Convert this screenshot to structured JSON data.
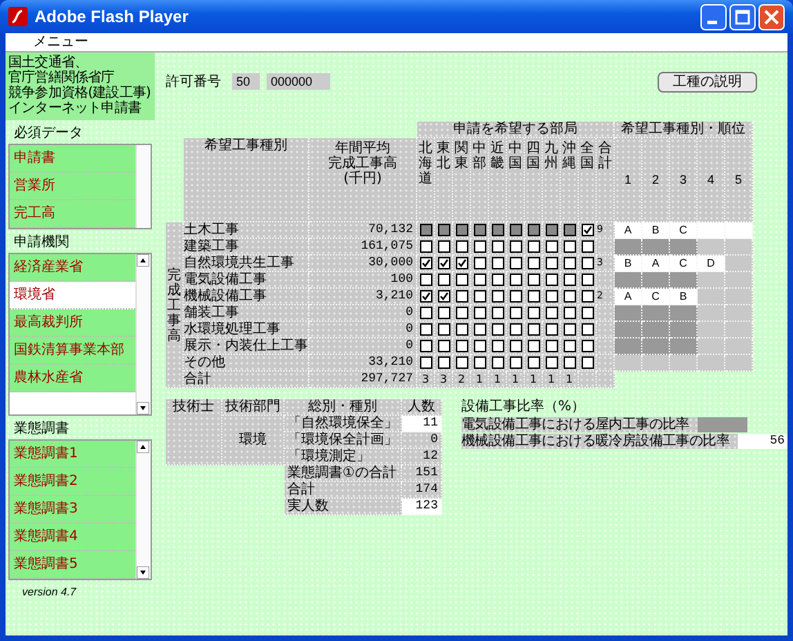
{
  "window": {
    "title": "Adobe Flash Player"
  },
  "menu": [
    "メニュー"
  ],
  "applicant_lines": [
    "国土交通省、",
    "官庁営繕関係省庁",
    "競争参加資格(建設工事)",
    "インターネット申請書"
  ],
  "permit": {
    "label": "許可番号",
    "prefix": "50",
    "number": "000000"
  },
  "help_button": "工種の説明",
  "sidebar": {
    "sections": [
      {
        "title": "必須データ",
        "scroll_arrows": false,
        "items": [
          {
            "label": "申請書",
            "selected": false
          },
          {
            "label": "営業所",
            "selected": false
          },
          {
            "label": "完工高",
            "selected": false
          }
        ]
      },
      {
        "title": "申請機関",
        "scroll_arrows": true,
        "items": [
          {
            "label": "経済産業省",
            "selected": false
          },
          {
            "label": "環境省",
            "selected": true
          },
          {
            "label": "最高裁判所",
            "selected": false
          },
          {
            "label": "国鉄清算事業本部",
            "selected": false
          },
          {
            "label": "農林水産省",
            "selected": false
          }
        ]
      },
      {
        "title": "業態調書",
        "scroll_arrows": true,
        "items": [
          {
            "label": "業態調書1",
            "selected": false
          },
          {
            "label": "業態調書2",
            "selected": false
          },
          {
            "label": "業態調書3",
            "selected": false
          },
          {
            "label": "業態調書4",
            "selected": false
          },
          {
            "label": "業態調書5",
            "selected": false
          }
        ]
      }
    ]
  },
  "version": "version 4.7",
  "table": {
    "group_headers": [
      "申請を希望する部局",
      "希望工事種別・順位"
    ],
    "type_header": "希望工事種別",
    "amount_header": [
      "年間平均",
      "完成工事高",
      "(千円)"
    ],
    "regions": [
      "北海道",
      "東北",
      "関東",
      "中部",
      "近畿",
      "中国",
      "四国",
      "九州",
      "沖縄",
      "全国",
      "合計"
    ],
    "ranks": [
      "1",
      "2",
      "3",
      "4",
      "5"
    ],
    "side_label": "完成工事高",
    "rows": [
      {
        "name": "土木工事",
        "amount": "70,132",
        "regions_disabled": true,
        "checks": [
          false,
          false,
          false,
          false,
          false,
          false,
          false,
          false,
          false,
          true
        ],
        "count": "9",
        "ranks": [
          {
            "kind": "input",
            "text": "A"
          },
          {
            "kind": "input",
            "text": "B"
          },
          {
            "kind": "input",
            "text": "C"
          },
          {
            "kind": "input"
          },
          {
            "kind": "input"
          }
        ]
      },
      {
        "name": "建築工事",
        "amount": "161,075",
        "regions_disabled": false,
        "checks": [
          false,
          false,
          false,
          false,
          false,
          false,
          false,
          false,
          false,
          false
        ],
        "ranks": [
          {
            "kind": "off"
          },
          {
            "kind": "off"
          },
          {
            "kind": "off"
          },
          {
            "kind": "none"
          },
          {
            "kind": "none"
          }
        ]
      },
      {
        "name": "自然環境共生工事",
        "amount": "30,000",
        "regions_disabled": false,
        "checks": [
          true,
          true,
          true,
          false,
          false,
          false,
          false,
          false,
          false,
          false
        ],
        "count": "3",
        "ranks": [
          {
            "kind": "input",
            "text": "B"
          },
          {
            "kind": "input",
            "text": "A"
          },
          {
            "kind": "input",
            "text": "C"
          },
          {
            "kind": "input",
            "text": "D"
          },
          {
            "kind": "none"
          }
        ]
      },
      {
        "name": "電気設備工事",
        "amount": "100",
        "regions_disabled": false,
        "checks": [
          false,
          false,
          false,
          false,
          false,
          false,
          false,
          false,
          false,
          false
        ],
        "ranks": [
          {
            "kind": "off"
          },
          {
            "kind": "off"
          },
          {
            "kind": "off"
          },
          {
            "kind": "none"
          },
          {
            "kind": "none"
          }
        ]
      },
      {
        "name": "機械設備工事",
        "amount": "3,210",
        "regions_disabled": false,
        "checks": [
          true,
          true,
          false,
          false,
          false,
          false,
          false,
          false,
          false,
          false
        ],
        "count": "2",
        "ranks": [
          {
            "kind": "input",
            "text": "A"
          },
          {
            "kind": "input",
            "text": "C"
          },
          {
            "kind": "input",
            "text": "B"
          },
          {
            "kind": "none"
          },
          {
            "kind": "none"
          }
        ]
      },
      {
        "name": "舗装工事",
        "amount": "0",
        "regions_disabled": false,
        "checks": [
          false,
          false,
          false,
          false,
          false,
          false,
          false,
          false,
          false,
          false
        ],
        "ranks": [
          {
            "kind": "off"
          },
          {
            "kind": "off"
          },
          {
            "kind": "off"
          },
          {
            "kind": "none"
          },
          {
            "kind": "none"
          }
        ]
      },
      {
        "name": "水環境処理工事",
        "amount": "0",
        "regions_disabled": false,
        "checks": [
          false,
          false,
          false,
          false,
          false,
          false,
          false,
          false,
          false,
          false
        ],
        "ranks": [
          {
            "kind": "off"
          },
          {
            "kind": "off"
          },
          {
            "kind": "off"
          },
          {
            "kind": "none"
          },
          {
            "kind": "none"
          }
        ]
      },
      {
        "name": "展示・内装仕上工事",
        "amount": "0",
        "regions_disabled": false,
        "checks": [
          false,
          false,
          false,
          false,
          false,
          false,
          false,
          false,
          false,
          false
        ],
        "ranks": [
          {
            "kind": "off"
          },
          {
            "kind": "off"
          },
          {
            "kind": "off"
          },
          {
            "kind": "none"
          },
          {
            "kind": "none"
          }
        ]
      },
      {
        "name": "その他",
        "amount": "33,210",
        "regions_disabled": false,
        "checks": [
          false,
          false,
          false,
          false,
          false,
          false,
          false,
          false,
          false,
          false
        ],
        "ranks": [
          {
            "kind": "none"
          },
          {
            "kind": "none"
          },
          {
            "kind": "none"
          },
          {
            "kind": "none"
          },
          {
            "kind": "none"
          }
        ]
      }
    ],
    "total": {
      "name": "合計",
      "amount": "297,727",
      "counts": [
        "3",
        "3",
        "2",
        "1",
        "1",
        "1",
        "1",
        "1",
        "1"
      ]
    }
  },
  "engineers": {
    "title": "技術士",
    "columns": [
      "技術部門",
      "総別・種別",
      "人数"
    ],
    "department": "環境",
    "rows": [
      {
        "label": "「自然環境保全」",
        "count": "11",
        "kind": "input"
      },
      {
        "label": "「環境保全計画」",
        "count": "0",
        "kind": "calc"
      },
      {
        "label": "「環境測定」",
        "count": "12",
        "kind": "calc"
      },
      {
        "label": "業態調書①の合計",
        "count": "151",
        "kind": "calc"
      },
      {
        "label": "合計",
        "count": "174",
        "kind": "calc"
      },
      {
        "label": "実人数",
        "count": "123",
        "kind": "input"
      }
    ]
  },
  "ratios": {
    "title": "設備工事比率（%）",
    "rows": [
      {
        "label": "電気設備工事における屋内工事の比率",
        "kind": "off"
      },
      {
        "label": "機械設備工事における暖冷房設備工事の比率",
        "kind": "input",
        "value": "56"
      }
    ]
  }
}
